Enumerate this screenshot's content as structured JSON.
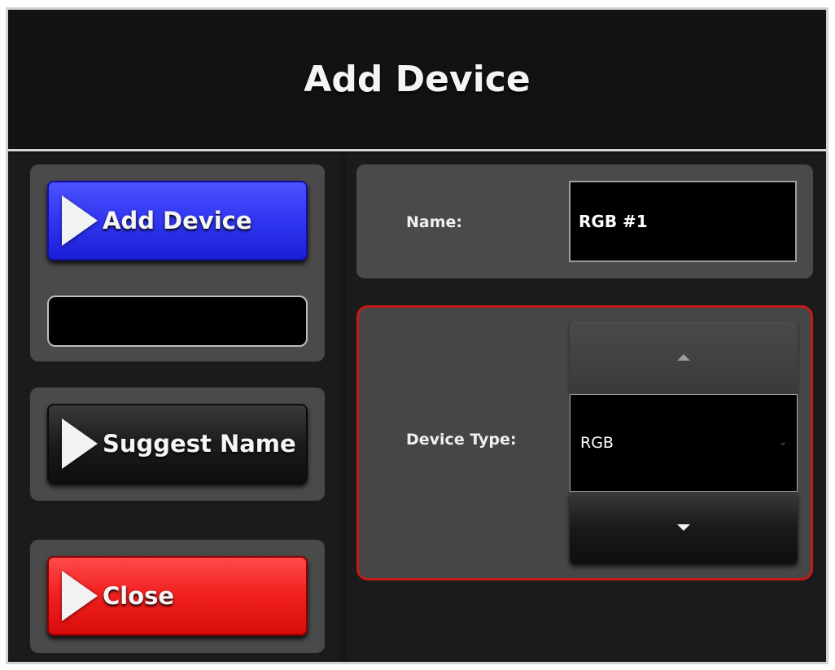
{
  "dialog": {
    "title": "Add Device"
  },
  "sidebar": {
    "add_device_button": "Add Device",
    "suggest_name_button": "Suggest Name",
    "close_button": "Close"
  },
  "form": {
    "name_label": "Name:",
    "name_value": "RGB #1",
    "device_type_label": "Device Type:",
    "device_type_value": "RGB"
  },
  "icons": {
    "button_icon": "play-triangle-icon",
    "stepper_up": "triangle-up-icon",
    "stepper_down": "triangle-down-icon",
    "select_chevron": "chevron-down-icon"
  },
  "colors": {
    "add_button": "#3338f2",
    "close_button": "#f22222",
    "focus_border": "#c41a1a",
    "panel": "#4a4a4a",
    "background": "#131313"
  }
}
